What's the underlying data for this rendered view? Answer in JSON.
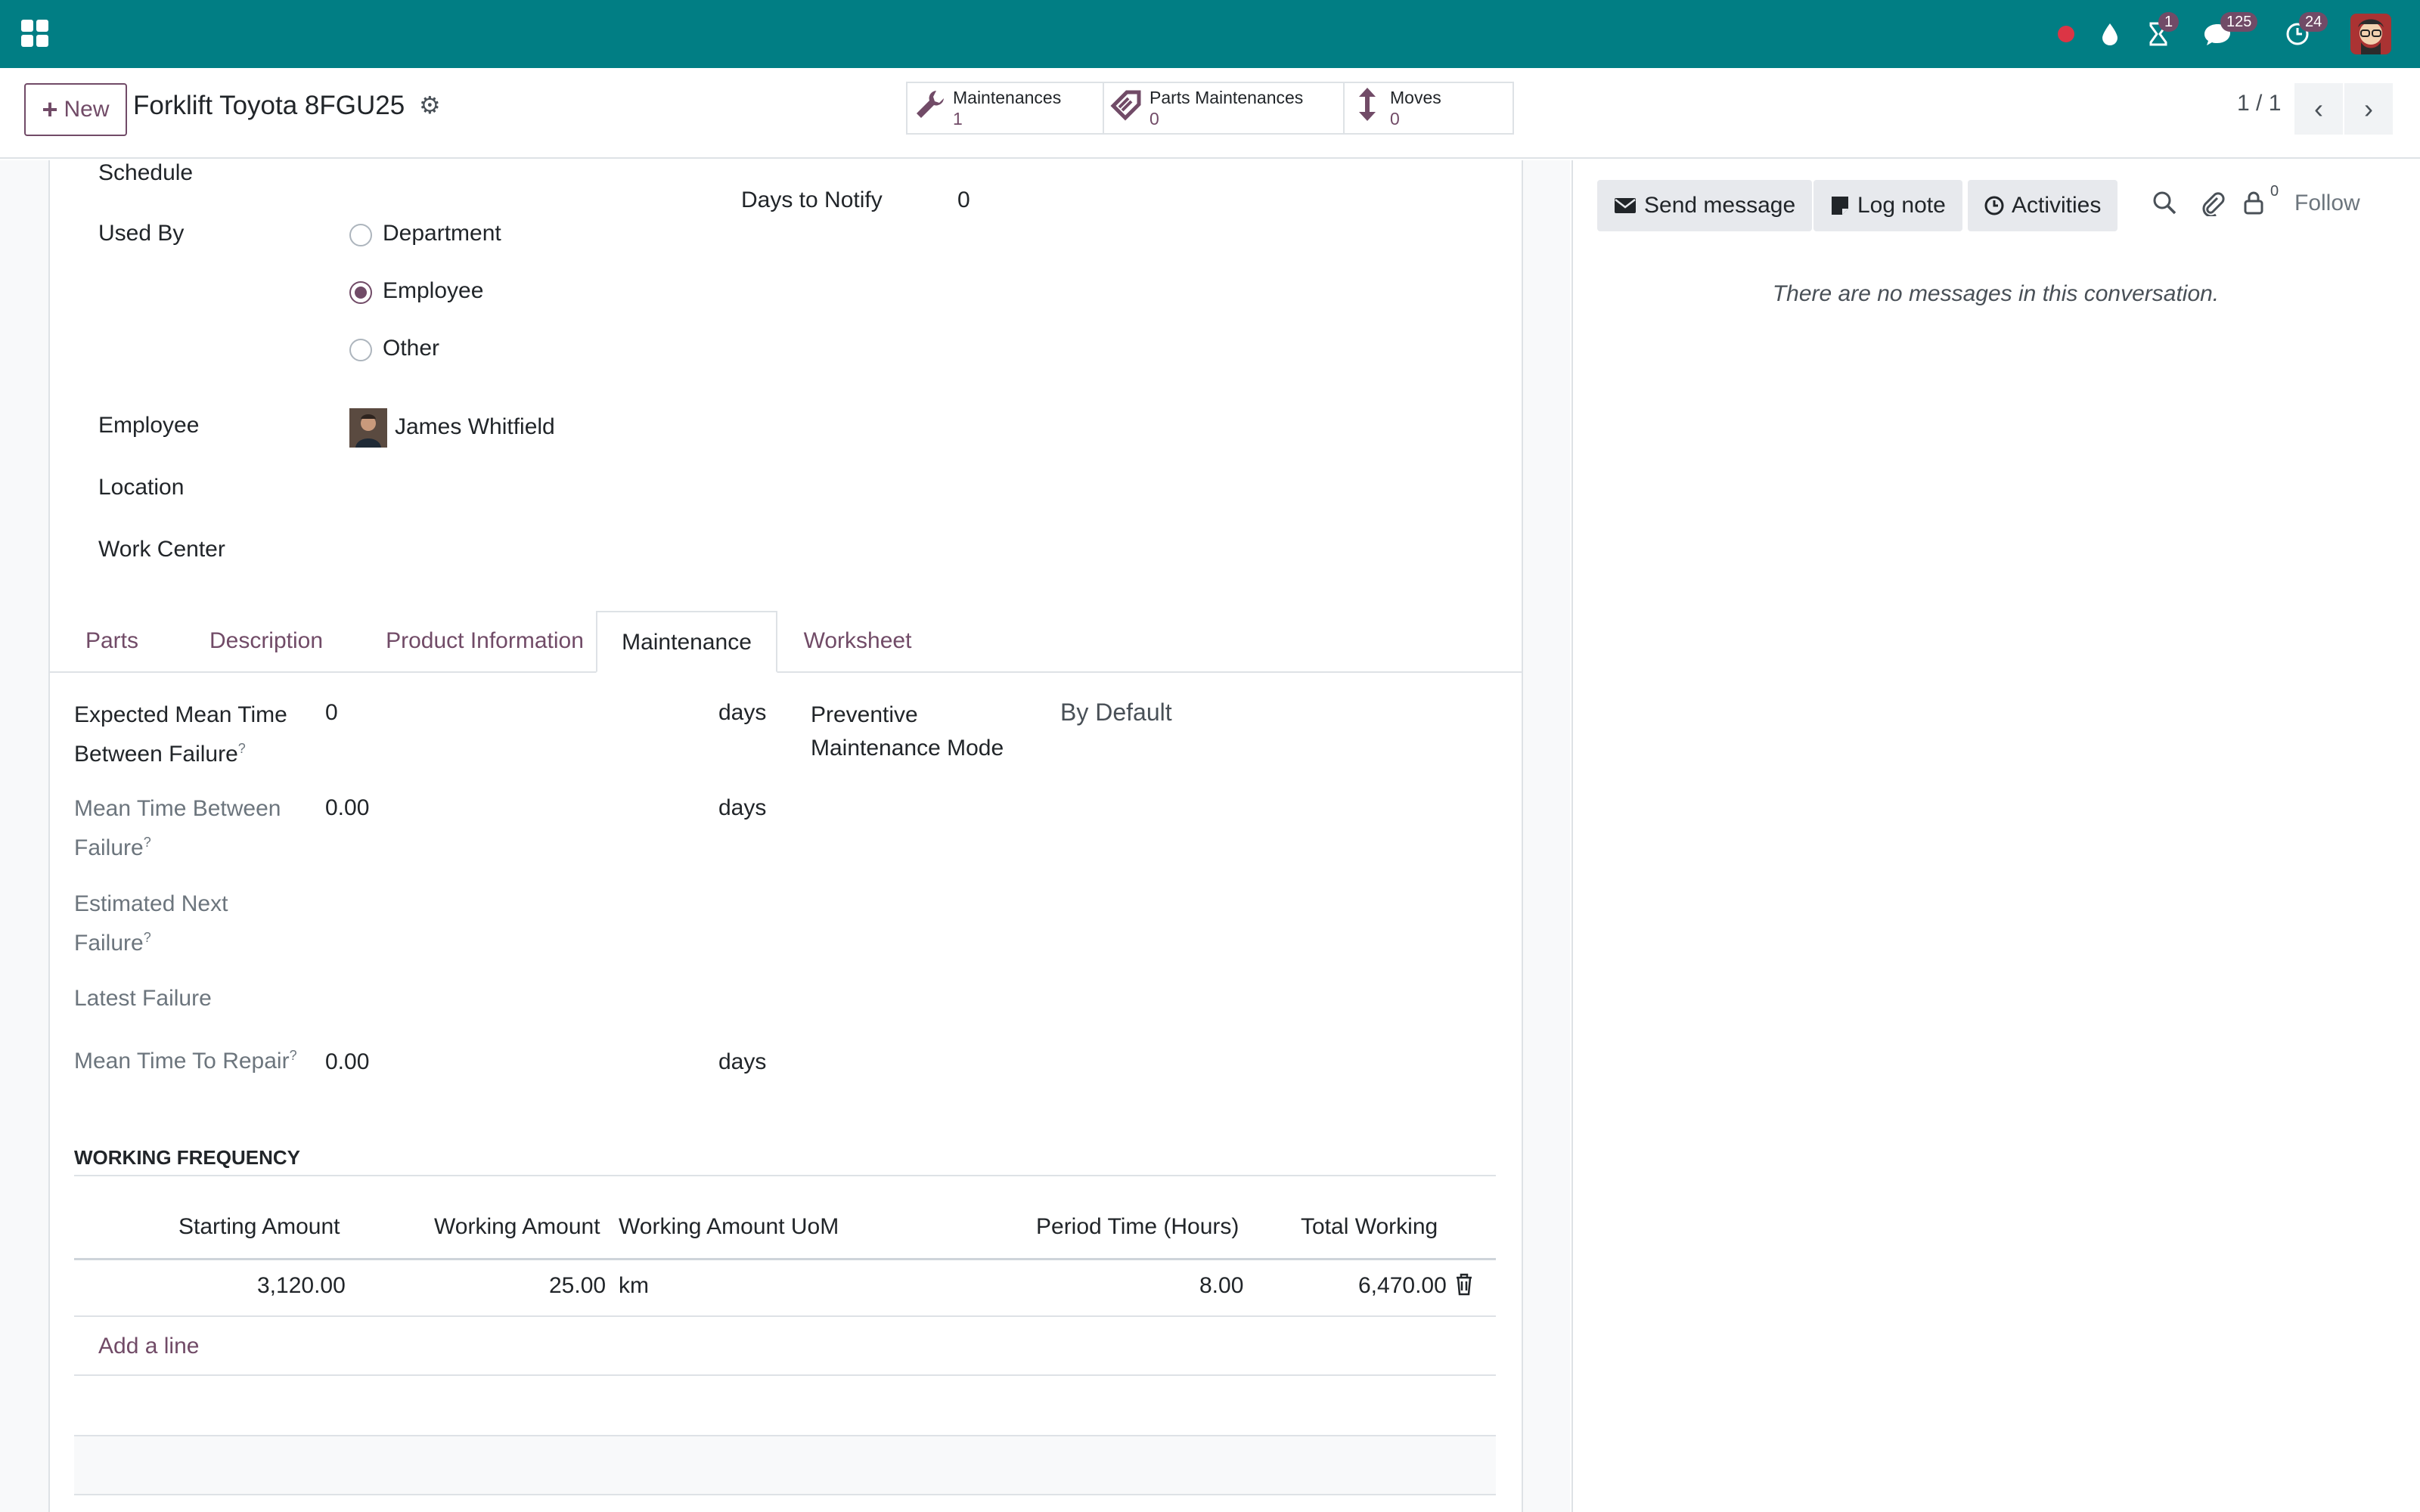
{
  "topbar": {
    "activity_badge": "1",
    "messages_badge": "125",
    "updates_badge": "24"
  },
  "control_panel": {
    "new_label": "New",
    "record_title": "Forklift Toyota 8FGU25",
    "smart_buttons": [
      {
        "label": "Maintenances",
        "count": "1",
        "icon": "wrench-icon"
      },
      {
        "label": "Parts Maintenances",
        "count": "0",
        "icon": "tag-icon"
      },
      {
        "label": "Moves",
        "count": "0",
        "icon": "updown-arrow-icon"
      }
    ],
    "pager": "1 / 1"
  },
  "form": {
    "schedule_label": "Schedule",
    "days_to_notify_label": "Days to Notify",
    "days_to_notify_value": "0",
    "used_by_label": "Used By",
    "used_by_options": [
      "Department",
      "Employee",
      "Other"
    ],
    "used_by_selected": "Employee",
    "employee_label": "Employee",
    "employee_value": "James Whitfield",
    "location_label": "Location",
    "work_center_label": "Work Center"
  },
  "tabs": [
    "Parts",
    "Description",
    "Product Information",
    "Maintenance",
    "Worksheet"
  ],
  "active_tab": "Maintenance",
  "maintenance": {
    "emtbf_label_1": "Expected Mean Time",
    "emtbf_label_2": "Between Failure",
    "emtbf_value": "0",
    "emtbf_unit": "days",
    "pm_mode_label_1": "Preventive",
    "pm_mode_label_2": "Maintenance Mode",
    "pm_mode_value": "By Default",
    "mtbf_label_1": "Mean Time Between",
    "mtbf_label_2": "Failure",
    "mtbf_value": "0.00",
    "mtbf_unit": "days",
    "enf_label_1": "Estimated Next",
    "enf_label_2": "Failure",
    "latest_failure_label": "Latest Failure",
    "mttr_label": "Mean Time To Repair",
    "mttr_value": "0.00",
    "mttr_unit": "days",
    "help_mark": "?"
  },
  "working_frequency": {
    "title": "WORKING FREQUENCY",
    "columns": [
      "Starting Amount",
      "Working Amount",
      "Working Amount UoM",
      "Period Time (Hours)",
      "Total Working"
    ],
    "rows": [
      [
        "3,120.00",
        "25.00",
        "km",
        "8.00",
        "6,470.00"
      ]
    ],
    "add_line": "Add a line"
  },
  "chatter": {
    "send_message": "Send message",
    "log_note": "Log note",
    "activities": "Activities",
    "followers_count": "0",
    "follow": "Follow",
    "empty_message": "There are no messages in this conversation."
  },
  "colors": {
    "navbar": "#017e84",
    "accent": "#714b67"
  }
}
